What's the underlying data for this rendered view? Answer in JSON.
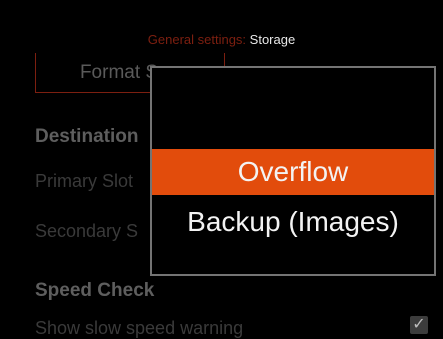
{
  "header": {
    "section": "General settings:",
    "page": "Storage"
  },
  "format_button": {
    "label": "Format S"
  },
  "destination": {
    "title": "Destination",
    "rows": [
      {
        "label": "Primary Slot"
      },
      {
        "label": "Secondary S"
      }
    ]
  },
  "speed_check": {
    "title": "Speed Check",
    "rows": [
      {
        "label": "Show slow speed warning",
        "checked": true
      }
    ]
  },
  "popup": {
    "options": [
      {
        "label": "Overflow",
        "selected": true
      },
      {
        "label": "Backup (Images)",
        "selected": false
      }
    ]
  },
  "colors": {
    "accent": "#e24c0c",
    "header_muted": "#7d1f10",
    "popup_border": "#747474"
  }
}
